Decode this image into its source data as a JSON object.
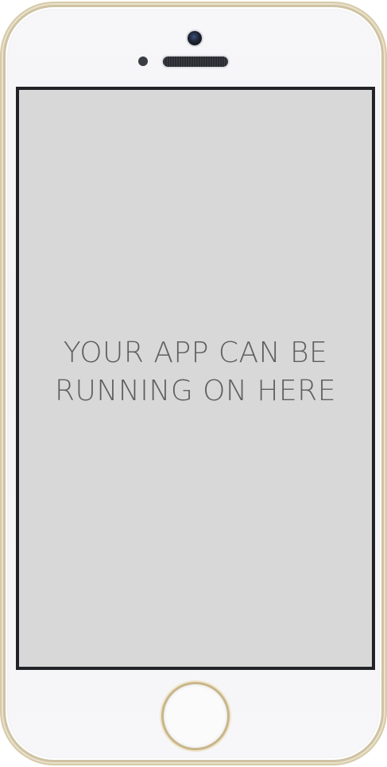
{
  "screen": {
    "message": "YOUR APP CAN BE RUNNING ON HERE"
  },
  "colors": {
    "screen_background": "#d8d8d8",
    "bezel_frame": "#cfc3a4",
    "screen_border": "#222326",
    "text": "#5f5f5f"
  }
}
